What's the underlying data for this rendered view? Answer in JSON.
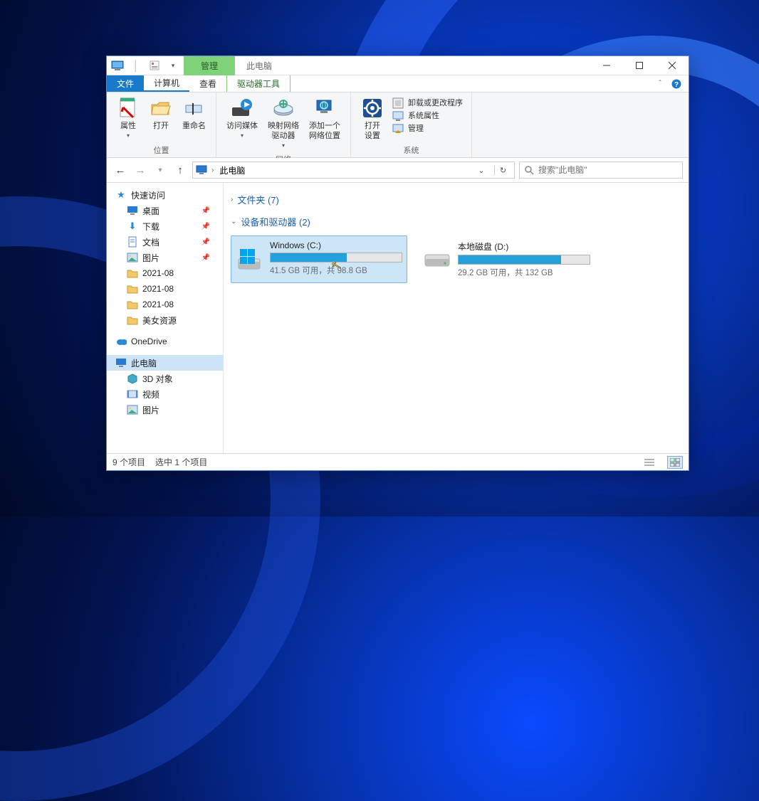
{
  "window": {
    "title": "此电脑",
    "ctx_tab_group": "管理"
  },
  "tabs": {
    "file": "文件",
    "computer": "计算机",
    "view": "查看",
    "drive_tools": "驱动器工具"
  },
  "ribbon": {
    "location": {
      "label": "位置",
      "properties": "属性",
      "open": "打开",
      "rename": "重命名"
    },
    "network": {
      "label": "网络",
      "access_media": "访问媒体",
      "map_drive": "映射网络\n驱动器",
      "add_location": "添加一个\n网络位置"
    },
    "system": {
      "label": "系统",
      "open_settings": "打开\n设置",
      "uninstall": "卸载或更改程序",
      "sys_props": "系统属性",
      "manage": "管理"
    }
  },
  "nav": {
    "address": "此电脑",
    "search_placeholder": "搜索\"此电脑\""
  },
  "tree": {
    "quick_access": "快速访问",
    "desktop": "桌面",
    "downloads": "下载",
    "documents": "文档",
    "pictures": "图片",
    "f1": "2021-08",
    "f2": "2021-08",
    "f3": "2021-08",
    "f4": "美女资源",
    "onedrive": "OneDrive",
    "this_pc": "此电脑",
    "objects3d": "3D 对象",
    "videos": "视频",
    "pictures2": "图片"
  },
  "content": {
    "folders_header": "文件夹 (7)",
    "drives_header": "设备和驱动器 (2)",
    "drives": [
      {
        "name": "Windows (C:)",
        "free": "41.5 GB 可用，共 98.8 GB",
        "fill_pct": 58
      },
      {
        "name": "本地磁盘 (D:)",
        "free": "29.2 GB 可用，共 132 GB",
        "fill_pct": 78
      }
    ]
  },
  "status": {
    "items": "9 个项目",
    "selected": "选中 1 个项目"
  }
}
